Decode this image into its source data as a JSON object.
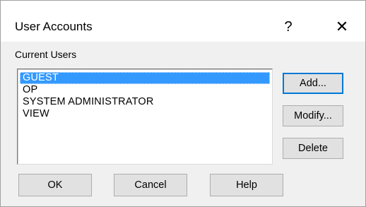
{
  "window": {
    "title": "User Accounts",
    "help_glyph": "?",
    "close_glyph": "✕"
  },
  "users_section": {
    "label": "Current Users",
    "items": [
      {
        "label": "GUEST",
        "selected": true
      },
      {
        "label": "OP",
        "selected": false
      },
      {
        "label": "SYSTEM ADMINISTRATOR",
        "selected": false
      },
      {
        "label": "VIEW",
        "selected": false
      }
    ]
  },
  "side_buttons": {
    "add": "Add...",
    "modify": "Modify...",
    "delete": "Delete"
  },
  "bottom_buttons": {
    "ok": "OK",
    "cancel": "Cancel",
    "help": "Help"
  },
  "colors": {
    "selection": "#3399ff",
    "default_button_border": "#0078d7",
    "dialog_background": "#f0f0f0"
  }
}
